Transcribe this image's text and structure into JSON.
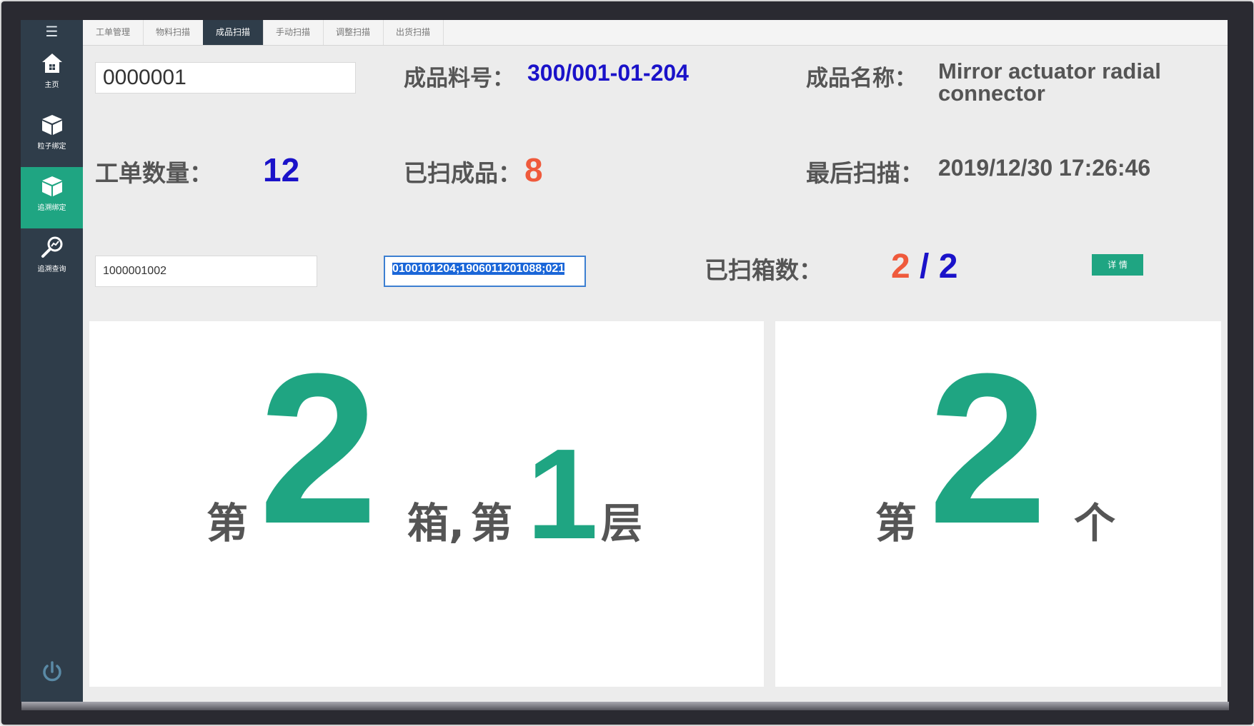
{
  "sidebar": {
    "menu_icon": "hamburger-icon",
    "items": [
      {
        "label": "主页",
        "icon": "home-icon",
        "active": false
      },
      {
        "label": "粒子绑定",
        "icon": "box-icon",
        "active": false
      },
      {
        "label": "追溯绑定",
        "icon": "box-icon",
        "active": true
      },
      {
        "label": "追溯查询",
        "icon": "magnifier-chart-icon",
        "active": false
      }
    ],
    "power_icon": "power-icon"
  },
  "tabs": [
    {
      "label": "工单管理"
    },
    {
      "label": "物料扫描"
    },
    {
      "label": "成品扫描",
      "active": true
    },
    {
      "label": "手动扫描"
    },
    {
      "label": "调整扫描"
    },
    {
      "label": "出货扫描"
    }
  ],
  "order": {
    "id_value": "0000001",
    "part_no_label": "成品料号：",
    "part_no_value": "300/001-01-204",
    "name_label": "成品名称：",
    "name_value_line1": "Mirror actuator radial",
    "name_value_line2": "connector",
    "qty_label": "工单数量：",
    "qty_value": "12",
    "scanned_label": "已扫成品：",
    "scanned_value": "8",
    "last_scan_label": "最后扫描：",
    "last_scan_value": "2019/12/30 17:26:46",
    "box_code_value": "1000001002",
    "barcode_value": "0100101204;1906011201088;021",
    "boxes_label": "已扫箱数：",
    "boxes_scanned": "2",
    "boxes_sep": "/",
    "boxes_total": "2",
    "detail_button": "详 情"
  },
  "position": {
    "prefix": "第",
    "box_number": "2",
    "box_unit": "箱,",
    "layer_prefix": "第",
    "layer_number": "1",
    "layer_unit": "层"
  },
  "piece": {
    "prefix": "第",
    "number": "2",
    "unit": "个"
  },
  "colors": {
    "accent": "#1fa582",
    "sidebar": "#2f3d4a",
    "blue_value": "#1a12c9",
    "red_value": "#ef5a3c"
  }
}
